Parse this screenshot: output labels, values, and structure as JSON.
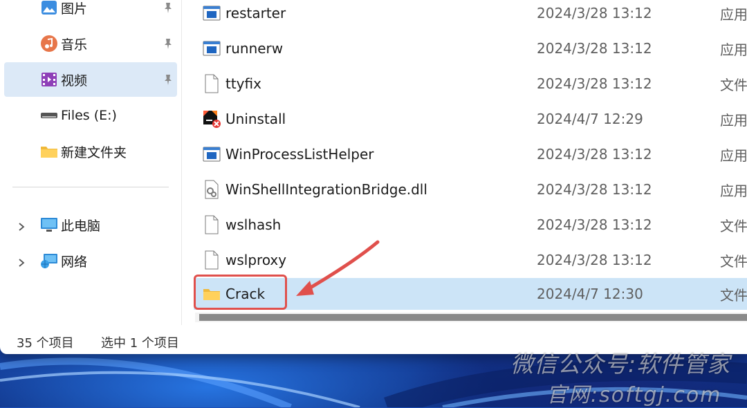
{
  "nav": {
    "items": [
      {
        "label": "图片",
        "icon": "pictures-icon",
        "pinned": true
      },
      {
        "label": "音乐",
        "icon": "music-icon",
        "pinned": true
      },
      {
        "label": "视频",
        "icon": "videos-icon",
        "pinned": true,
        "selected": true
      },
      {
        "label": "Files (E:)",
        "icon": "drive-icon",
        "pinned": false
      },
      {
        "label": "新建文件夹",
        "icon": "folder-icon",
        "pinned": false
      },
      {
        "label": "此电脑",
        "icon": "this-pc-icon",
        "expandable": true
      },
      {
        "label": "网络",
        "icon": "network-icon",
        "expandable": true
      }
    ]
  },
  "files": [
    {
      "name": "restarter",
      "date": "2024/3/28 13:12",
      "type": "应用",
      "icon": "app-icon"
    },
    {
      "name": "runnerw",
      "date": "2024/3/28 13:12",
      "type": "应用",
      "icon": "app-icon"
    },
    {
      "name": "ttyfix",
      "date": "2024/3/28 13:12",
      "type": "文件",
      "icon": "file-icon"
    },
    {
      "name": "Uninstall",
      "date": "2024/4/7 12:29",
      "type": "应用",
      "icon": "uninstall-icon"
    },
    {
      "name": "WinProcessListHelper",
      "date": "2024/3/28 13:12",
      "type": "应用",
      "icon": "app-icon"
    },
    {
      "name": "WinShellIntegrationBridge.dll",
      "date": "2024/3/28 13:12",
      "type": "应用",
      "icon": "dll-icon"
    },
    {
      "name": "wslhash",
      "date": "2024/3/28 13:12",
      "type": "文件",
      "icon": "file-icon"
    },
    {
      "name": "wslproxy",
      "date": "2024/3/28 13:12",
      "type": "文件",
      "icon": "file-icon"
    },
    {
      "name": "Crack",
      "date": "2024/4/7 12:30",
      "type": "文件",
      "icon": "folder-icon",
      "selected": true
    }
  ],
  "status": {
    "item_count": "35 个项目",
    "selection": "选中 1 个项目"
  },
  "watermark": {
    "line1": "微信公众号:软件管家",
    "line2": "官网:softgj.com"
  },
  "colors": {
    "selected_row": "#cce4f7",
    "nav_selected": "#dce9f7",
    "annotation": "#e0504c"
  }
}
